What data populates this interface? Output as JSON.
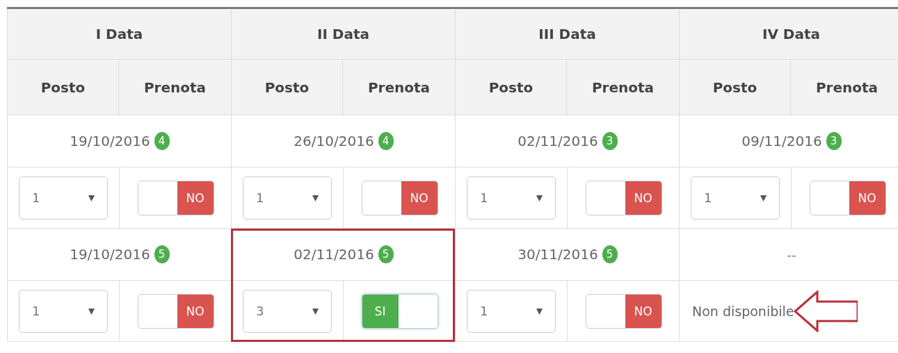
{
  "table": {
    "groups": [
      {
        "title": "I Data",
        "columns": [
          "Posto",
          "Prenota"
        ]
      },
      {
        "title": "II Data",
        "columns": [
          "Posto",
          "Prenota"
        ]
      },
      {
        "title": "III Data",
        "columns": [
          "Posto",
          "Prenota"
        ]
      },
      {
        "title": "IV Data",
        "columns": [
          "Posto",
          "Prenota"
        ]
      }
    ],
    "rows": [
      [
        {
          "kind": "slot",
          "date": "19/10/2016",
          "badge": "4",
          "seat": "1",
          "toggle_label": "NO",
          "booked": false,
          "highlighted": false
        },
        {
          "kind": "slot",
          "date": "26/10/2016",
          "badge": "4",
          "seat": "1",
          "toggle_label": "NO",
          "booked": false,
          "highlighted": false
        },
        {
          "kind": "slot",
          "date": "02/11/2016",
          "badge": "3",
          "seat": "1",
          "toggle_label": "NO",
          "booked": false,
          "highlighted": false
        },
        {
          "kind": "slot",
          "date": "09/11/2016",
          "badge": "3",
          "seat": "1",
          "toggle_label": "NO",
          "booked": false,
          "highlighted": false
        }
      ],
      [
        {
          "kind": "slot",
          "date": "19/10/2016",
          "badge": "5",
          "seat": "1",
          "toggle_label": "NO",
          "booked": false,
          "highlighted": false
        },
        {
          "kind": "slot",
          "date": "02/11/2016",
          "badge": "5",
          "seat": "3",
          "toggle_label": "SI",
          "booked": true,
          "highlighted": true
        },
        {
          "kind": "slot",
          "date": "30/11/2016",
          "badge": "5",
          "seat": "1",
          "toggle_label": "NO",
          "booked": false,
          "highlighted": false
        },
        {
          "kind": "unavailable",
          "date": "--",
          "note": "Non disponibile",
          "pointed": true
        }
      ]
    ]
  }
}
